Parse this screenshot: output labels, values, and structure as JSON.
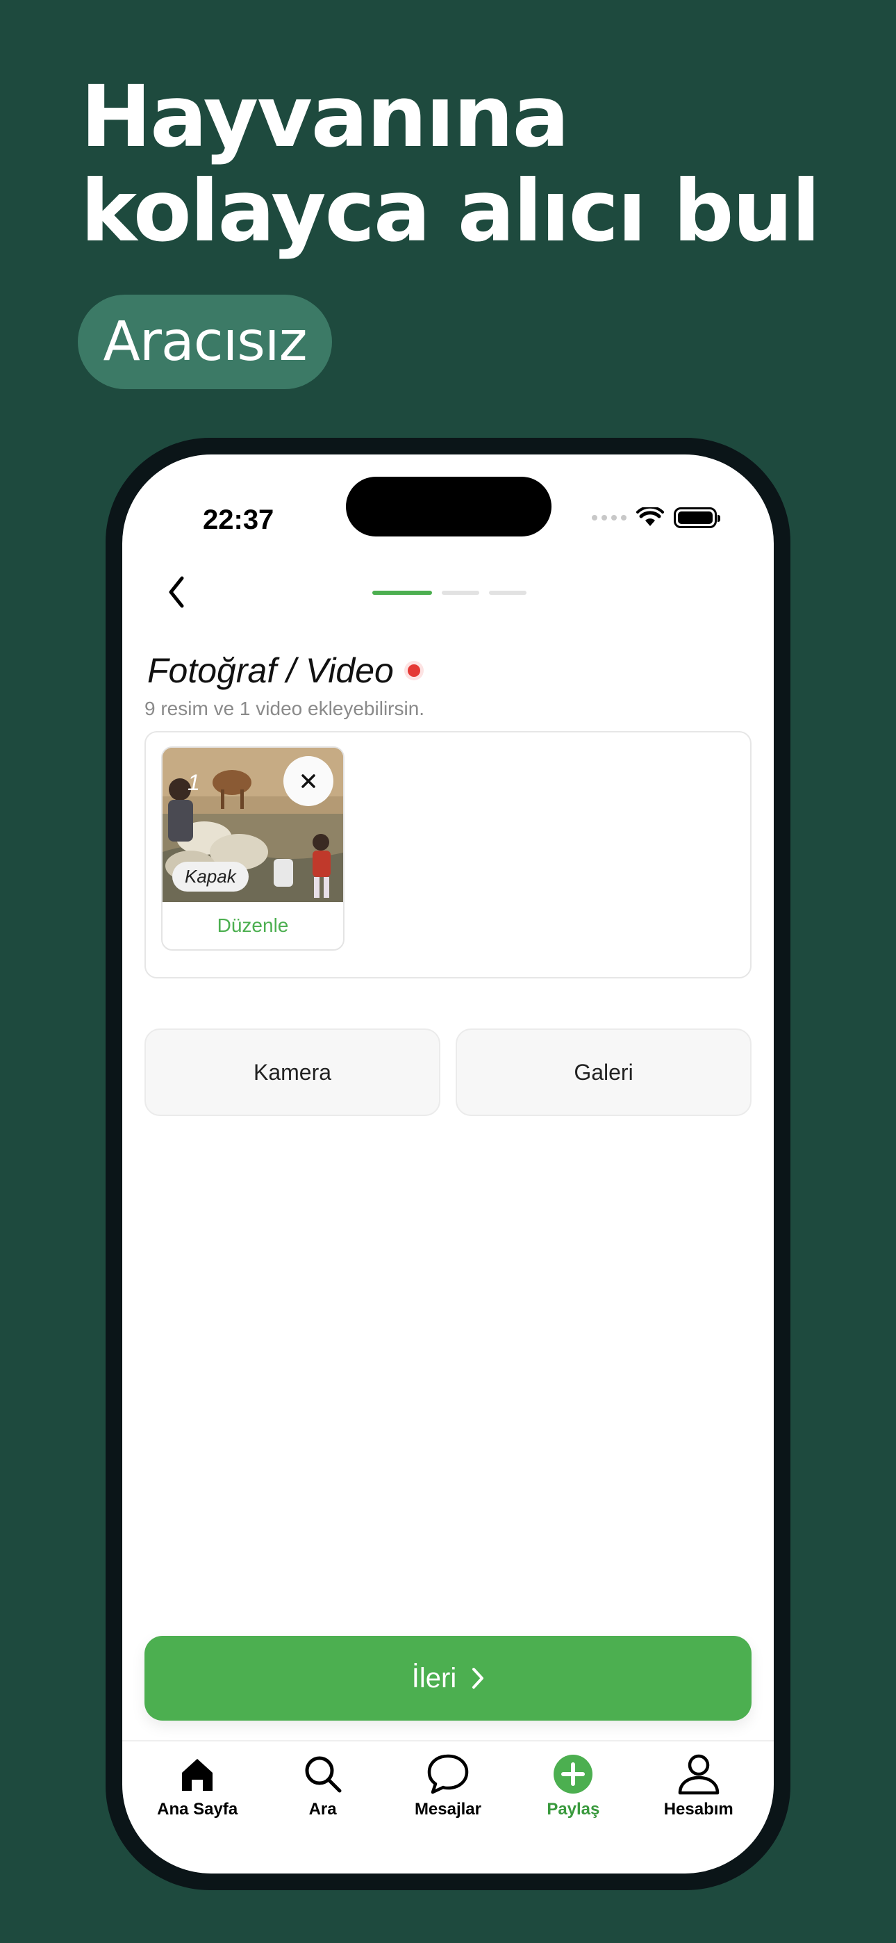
{
  "promo": {
    "headline_line1": "Hayvanına",
    "headline_line2": "kolayca alıcı bul",
    "tag": "Aracısız"
  },
  "status_bar": {
    "time": "22:37"
  },
  "form": {
    "step_current": 1,
    "step_total": 3,
    "section_title": "Fotoğraf / Video",
    "section_subtitle": "9 resim ve 1 video ekleyebilirsin.",
    "media": [
      {
        "index": "1",
        "cover_label": "Kapak",
        "edit_label": "Düzenle"
      }
    ],
    "camera_button": "Kamera",
    "gallery_button": "Galeri",
    "next_button": "İleri"
  },
  "tabbar": {
    "items": [
      {
        "label": "Ana Sayfa",
        "icon": "home-icon",
        "active": false
      },
      {
        "label": "Ara",
        "icon": "search-icon",
        "active": false
      },
      {
        "label": "Mesajlar",
        "icon": "chat-bubble-icon",
        "active": false
      },
      {
        "label": "Paylaş",
        "icon": "plus-circle-icon",
        "active": true
      },
      {
        "label": "Hesabım",
        "icon": "person-icon",
        "active": false
      }
    ]
  },
  "colors": {
    "background": "#1e4a3e",
    "pill": "#3c7a66",
    "accent": "#4caf50",
    "required_dot": "#e53935"
  }
}
